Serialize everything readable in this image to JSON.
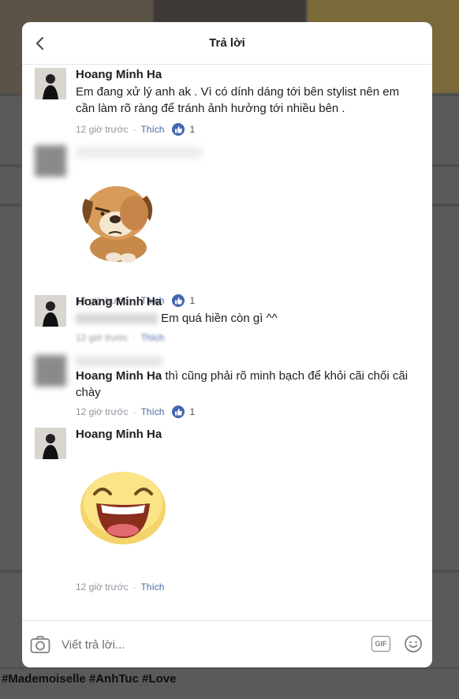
{
  "header": {
    "title": "Trả lời"
  },
  "comments": [
    {
      "name": "Hoang Minh Ha",
      "text": "Em đang xử lý anh ak . Vì có dính dáng tới bên stylist nên em cần làm rõ ràng để tránh ảnh hưởng tới nhiều bên .",
      "time": "12 giờ trước",
      "like_label": "Thích",
      "likes": "1"
    },
    {
      "time": "12 giờ trước",
      "like_label": "Thích",
      "likes": "1",
      "sticker": "puppy-facepalm-sticker"
    },
    {
      "name": "Hoang Minh Ha",
      "text": "Em quá hiền còn gì ^^",
      "time": "12 giờ trước",
      "like_label": "Thích"
    },
    {
      "mention": "Hoang Minh Ha",
      "text": "thì cũng phải rõ minh bạch để khỏi cãi chối cãi chày",
      "time": "12 giờ trước",
      "like_label": "Thích",
      "likes": "1"
    },
    {
      "name": "Hoang Minh Ha",
      "time": "12 giờ trước",
      "like_label": "Thích",
      "sticker": "laughing-face-sticker"
    }
  ],
  "composer": {
    "placeholder": "Viết trả lời..."
  },
  "background": {
    "hashtags": "#Mademoiselle #AnhTuc #Love"
  },
  "colors": {
    "like_blue": "#4267b2",
    "link_blue": "#4a67a8",
    "meta_gray": "#90949c"
  }
}
